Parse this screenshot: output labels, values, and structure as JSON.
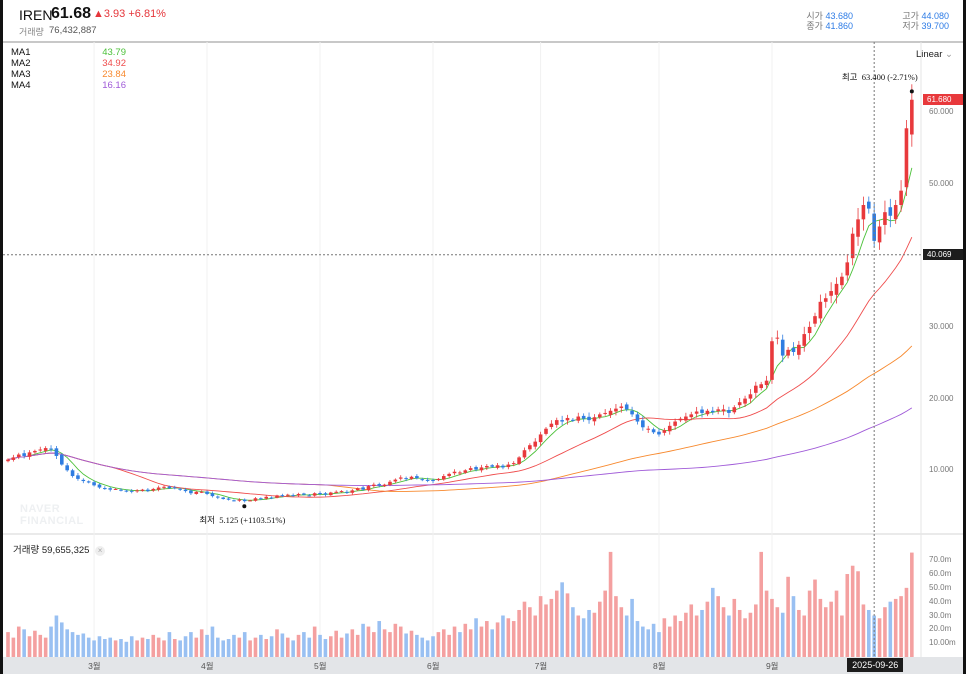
{
  "header": {
    "symbol": "IREN",
    "price": "61.68",
    "change": "▲3.93 +6.81%",
    "volume_label": "거래량",
    "volume_value": "76,432,887",
    "open_label": "시가",
    "open": "43.680",
    "high_label": "고가",
    "high": "44.080",
    "close_label": "종가",
    "close": "41.860",
    "low_label": "저가",
    "low": "39.700"
  },
  "legend": [
    {
      "name": "MA1",
      "value": "43.79",
      "color": "#4cc13a"
    },
    {
      "name": "MA2",
      "value": "34.92",
      "color": "#ef4d4d"
    },
    {
      "name": "MA3",
      "value": "23.84",
      "color": "#f7892e"
    },
    {
      "name": "MA4",
      "value": "16.16",
      "color": "#a05bd8"
    }
  ],
  "scale_mode": "Linear",
  "watermark": "NAVER FINANCIAL",
  "volume_panel": {
    "label": "거래량",
    "value": "59,655,325",
    "close_icon": "×"
  },
  "colors": {
    "up": "#e8393c",
    "down": "#2f7de1",
    "up_vol": "#f4a0a0",
    "down_vol": "#99c0f2"
  },
  "chart_data": {
    "type": "candlestick",
    "price_axis": {
      "ticks": [
        "60.000",
        "50.000",
        "30.000",
        "20.000",
        "10.000"
      ],
      "tick_values": [
        60,
        50,
        30,
        20,
        10
      ],
      "current_tag": "61.680",
      "current": 61.68,
      "crosshair_tag": "40.069",
      "crosshair": 40.069
    },
    "volume_axis": {
      "ticks": [
        "70.0m",
        "60.0m",
        "50.0m",
        "40.0m",
        "30.0m",
        "20.0m",
        "10.00m"
      ],
      "tick_values": [
        70,
        60,
        50,
        40,
        30,
        20,
        10
      ]
    },
    "months": [
      {
        "label": "3월",
        "index": 16
      },
      {
        "label": "4월",
        "index": 37
      },
      {
        "label": "5월",
        "index": 58
      },
      {
        "label": "6월",
        "index": 79
      },
      {
        "label": "7월",
        "index": 99
      },
      {
        "label": "8월",
        "index": 121
      },
      {
        "label": "9월",
        "index": 142
      }
    ],
    "crosshair_date": "2025-09-26",
    "crosshair_index": 161,
    "high_annotation": {
      "text": "최고  63.400 (-2.71%)",
      "value": 63.4,
      "index": 168
    },
    "low_annotation": {
      "text": "최저  5.125 (+1103.51%)",
      "value": 5.125,
      "index": 43
    },
    "close": [
      11.5,
      11.8,
      12.2,
      12.0,
      12.5,
      12.7,
      12.9,
      13.1,
      13.0,
      12.0,
      10.8,
      10.0,
      9.2,
      8.8,
      8.5,
      8.3,
      7.9,
      7.6,
      7.5,
      7.3,
      7.4,
      7.2,
      7.1,
      7.0,
      7.2,
      7.3,
      7.1,
      7.4,
      7.6,
      7.7,
      7.5,
      7.5,
      7.3,
      7.1,
      6.8,
      7.0,
      7.0,
      6.7,
      6.4,
      6.2,
      6.0,
      5.9,
      5.8,
      5.9,
      5.7,
      5.8,
      6.1,
      6.0,
      6.3,
      6.2,
      6.5,
      6.4,
      6.6,
      6.5,
      6.7,
      6.6,
      6.5,
      6.8,
      6.7,
      6.6,
      6.9,
      7.0,
      7.1,
      6.9,
      7.2,
      7.5,
      7.3,
      7.8,
      8.0,
      7.9,
      8.0,
      8.4,
      8.7,
      9.0,
      8.8,
      9.1,
      8.9,
      8.7,
      8.6,
      8.5,
      8.8,
      9.2,
      9.5,
      9.8,
      9.7,
      10.0,
      10.3,
      10.1,
      10.4,
      10.6,
      10.5,
      10.7,
      10.4,
      10.8,
      11.0,
      11.8,
      12.8,
      13.5,
      14.0,
      15.0,
      15.8,
      16.5,
      17.0,
      16.8,
      17.3,
      17.0,
      17.5,
      17.2,
      17.0,
      17.4,
      17.8,
      18.0,
      18.3,
      18.6,
      18.9,
      18.5,
      17.8,
      16.8,
      16.0,
      15.8,
      15.3,
      15.0,
      15.6,
      16.2,
      16.8,
      17.2,
      17.5,
      17.8,
      18.2,
      18.0,
      18.3,
      18.1,
      18.5,
      18.5,
      18.0,
      18.8,
      19.5,
      20.0,
      20.6,
      21.8,
      22.0,
      22.5,
      28.0,
      28.5,
      26.0,
      26.8,
      26.5,
      27.5,
      29.0,
      30.0,
      31.5,
      33.5,
      34.0,
      35.0,
      36.0,
      37.0,
      39.0,
      43.0,
      45.0,
      47.0,
      46.5,
      42.0,
      44.0,
      46.0,
      45.5,
      47.0,
      49.0,
      57.7,
      61.68
    ],
    "volume_m": [
      18,
      14,
      22,
      20,
      15,
      19,
      16,
      14,
      22,
      30,
      25,
      20,
      18,
      16,
      17,
      14,
      12,
      15,
      13,
      14,
      12,
      13,
      11,
      15,
      12,
      14,
      13,
      16,
      14,
      12,
      18,
      13,
      12,
      15,
      18,
      14,
      20,
      16,
      22,
      14,
      12,
      13,
      16,
      14,
      18,
      12,
      14,
      16,
      13,
      15,
      20,
      17,
      14,
      12,
      16,
      18,
      14,
      22,
      16,
      13,
      15,
      19,
      14,
      17,
      20,
      16,
      24,
      22,
      18,
      26,
      20,
      18,
      24,
      22,
      17,
      19,
      16,
      14,
      12,
      15,
      18,
      20,
      16,
      22,
      18,
      24,
      20,
      28,
      22,
      26,
      20,
      25,
      30,
      28,
      26,
      34,
      40,
      36,
      30,
      44,
      38,
      42,
      48,
      54,
      46,
      36,
      30,
      28,
      34,
      32,
      40,
      48,
      76,
      44,
      36,
      30,
      42,
      26,
      22,
      20,
      24,
      18,
      28,
      22,
      30,
      26,
      32,
      38,
      30,
      34,
      40,
      50,
      44,
      36,
      30,
      42,
      34,
      28,
      32,
      38,
      76,
      48,
      42,
      36,
      32,
      58,
      44,
      34,
      30,
      48,
      56,
      42,
      36,
      40,
      48,
      30,
      60,
      66,
      62,
      38,
      34,
      30,
      28,
      36,
      40,
      42,
      44,
      50,
      75.5
    ]
  }
}
